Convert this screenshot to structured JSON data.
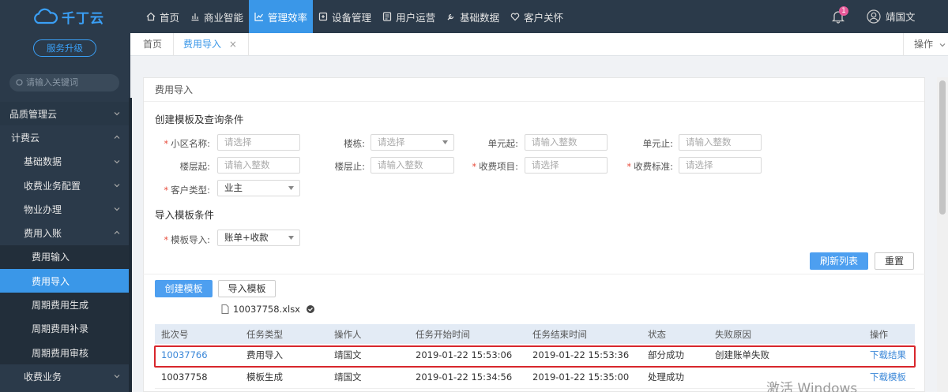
{
  "topbar": {
    "logo_text": "千丁云",
    "nav": [
      {
        "label": "首页",
        "icon": "home-icon"
      },
      {
        "label": "商业智能",
        "icon": "chart-icon"
      },
      {
        "label": "管理效率",
        "icon": "trend-icon"
      },
      {
        "label": "设备管理",
        "icon": "device-icon"
      },
      {
        "label": "用户运营",
        "icon": "users-icon"
      },
      {
        "label": "基础数据",
        "icon": "wrench-icon"
      },
      {
        "label": "客户关怀",
        "icon": "heart-icon"
      }
    ],
    "active_nav": "管理效率",
    "notification_count": "1",
    "user_name": "靖国文"
  },
  "sidebar": {
    "upgrade_label": "服务升级",
    "search_placeholder": "请输入关键词",
    "menu": [
      {
        "label": "品质管理云",
        "level": 0,
        "chevron": "down"
      },
      {
        "label": "计费云",
        "level": 1,
        "chevron": "up"
      },
      {
        "label": "基础数据",
        "level": 2,
        "chevron": "down"
      },
      {
        "label": "收费业务配置",
        "level": 2,
        "chevron": "down"
      },
      {
        "label": "物业办理",
        "level": 2,
        "chevron": "down"
      },
      {
        "label": "费用入账",
        "level": 2,
        "chevron": "up"
      },
      {
        "label": "费用输入",
        "level": 3
      },
      {
        "label": "费用导入",
        "level": 3,
        "active": true
      },
      {
        "label": "周期费用生成",
        "level": 3
      },
      {
        "label": "周期费用补录",
        "level": 3
      },
      {
        "label": "周期费用审核",
        "level": 3
      },
      {
        "label": "收费业务",
        "level": 2,
        "chevron": "down"
      }
    ]
  },
  "tabs": {
    "items": [
      {
        "label": "首页"
      },
      {
        "label": "费用导入",
        "closable": "×"
      }
    ],
    "ops_label": "操作"
  },
  "panel": {
    "title": "费用导入",
    "section_query": "创建模板及查询条件",
    "section_import": "导入模板条件",
    "fields": {
      "community": {
        "label": "小区名称:",
        "placeholder": "请选择",
        "required": true
      },
      "building": {
        "label": "楼栋:",
        "placeholder": "请选择"
      },
      "unit_from": {
        "label": "单元起:",
        "placeholder": "请输入整数"
      },
      "unit_to": {
        "label": "单元止:",
        "placeholder": "请输入整数"
      },
      "floor_from": {
        "label": "楼层起:",
        "placeholder": "请输入整数"
      },
      "floor_to": {
        "label": "楼层止:",
        "placeholder": "请输入整数"
      },
      "fee_item": {
        "label": "收费项目:",
        "placeholder": "请选择",
        "required": true
      },
      "fee_standard": {
        "label": "收费标准:",
        "placeholder": "请选择",
        "required": true
      },
      "customer_type": {
        "label": "客户类型:",
        "value": "业主",
        "required": true
      },
      "template_import": {
        "label": "模板导入:",
        "value": "账单+收款",
        "required": true
      }
    },
    "refresh_label": "刷新列表",
    "reset_label": "重置",
    "create_template_label": "创建模板",
    "import_template_label": "导入模板",
    "file_name": "10037758.xlsx"
  },
  "table": {
    "columns": [
      "批次号",
      "任务类型",
      "操作人",
      "任务开始时间",
      "任务结束时间",
      "状态",
      "失败原因",
      "操作"
    ],
    "rows": [
      [
        "10037766",
        "费用导入",
        "靖国文",
        "2019-01-22 15:53:06",
        "2019-01-22 15:53:36",
        "部分成功",
        "创建账单失败",
        "下载结果"
      ],
      [
        "10037758",
        "模板生成",
        "靖国文",
        "2019-01-22 15:34:56",
        "2019-01-22 15:35:00",
        "处理成功",
        "",
        "下载模板"
      ]
    ]
  },
  "watermark": "激活 Windows",
  "colors": {
    "topbar_bg": "#2b3a4a",
    "accent": "#3a97e8",
    "highlight_border": "#d8262c",
    "required": "#e74c3c"
  }
}
